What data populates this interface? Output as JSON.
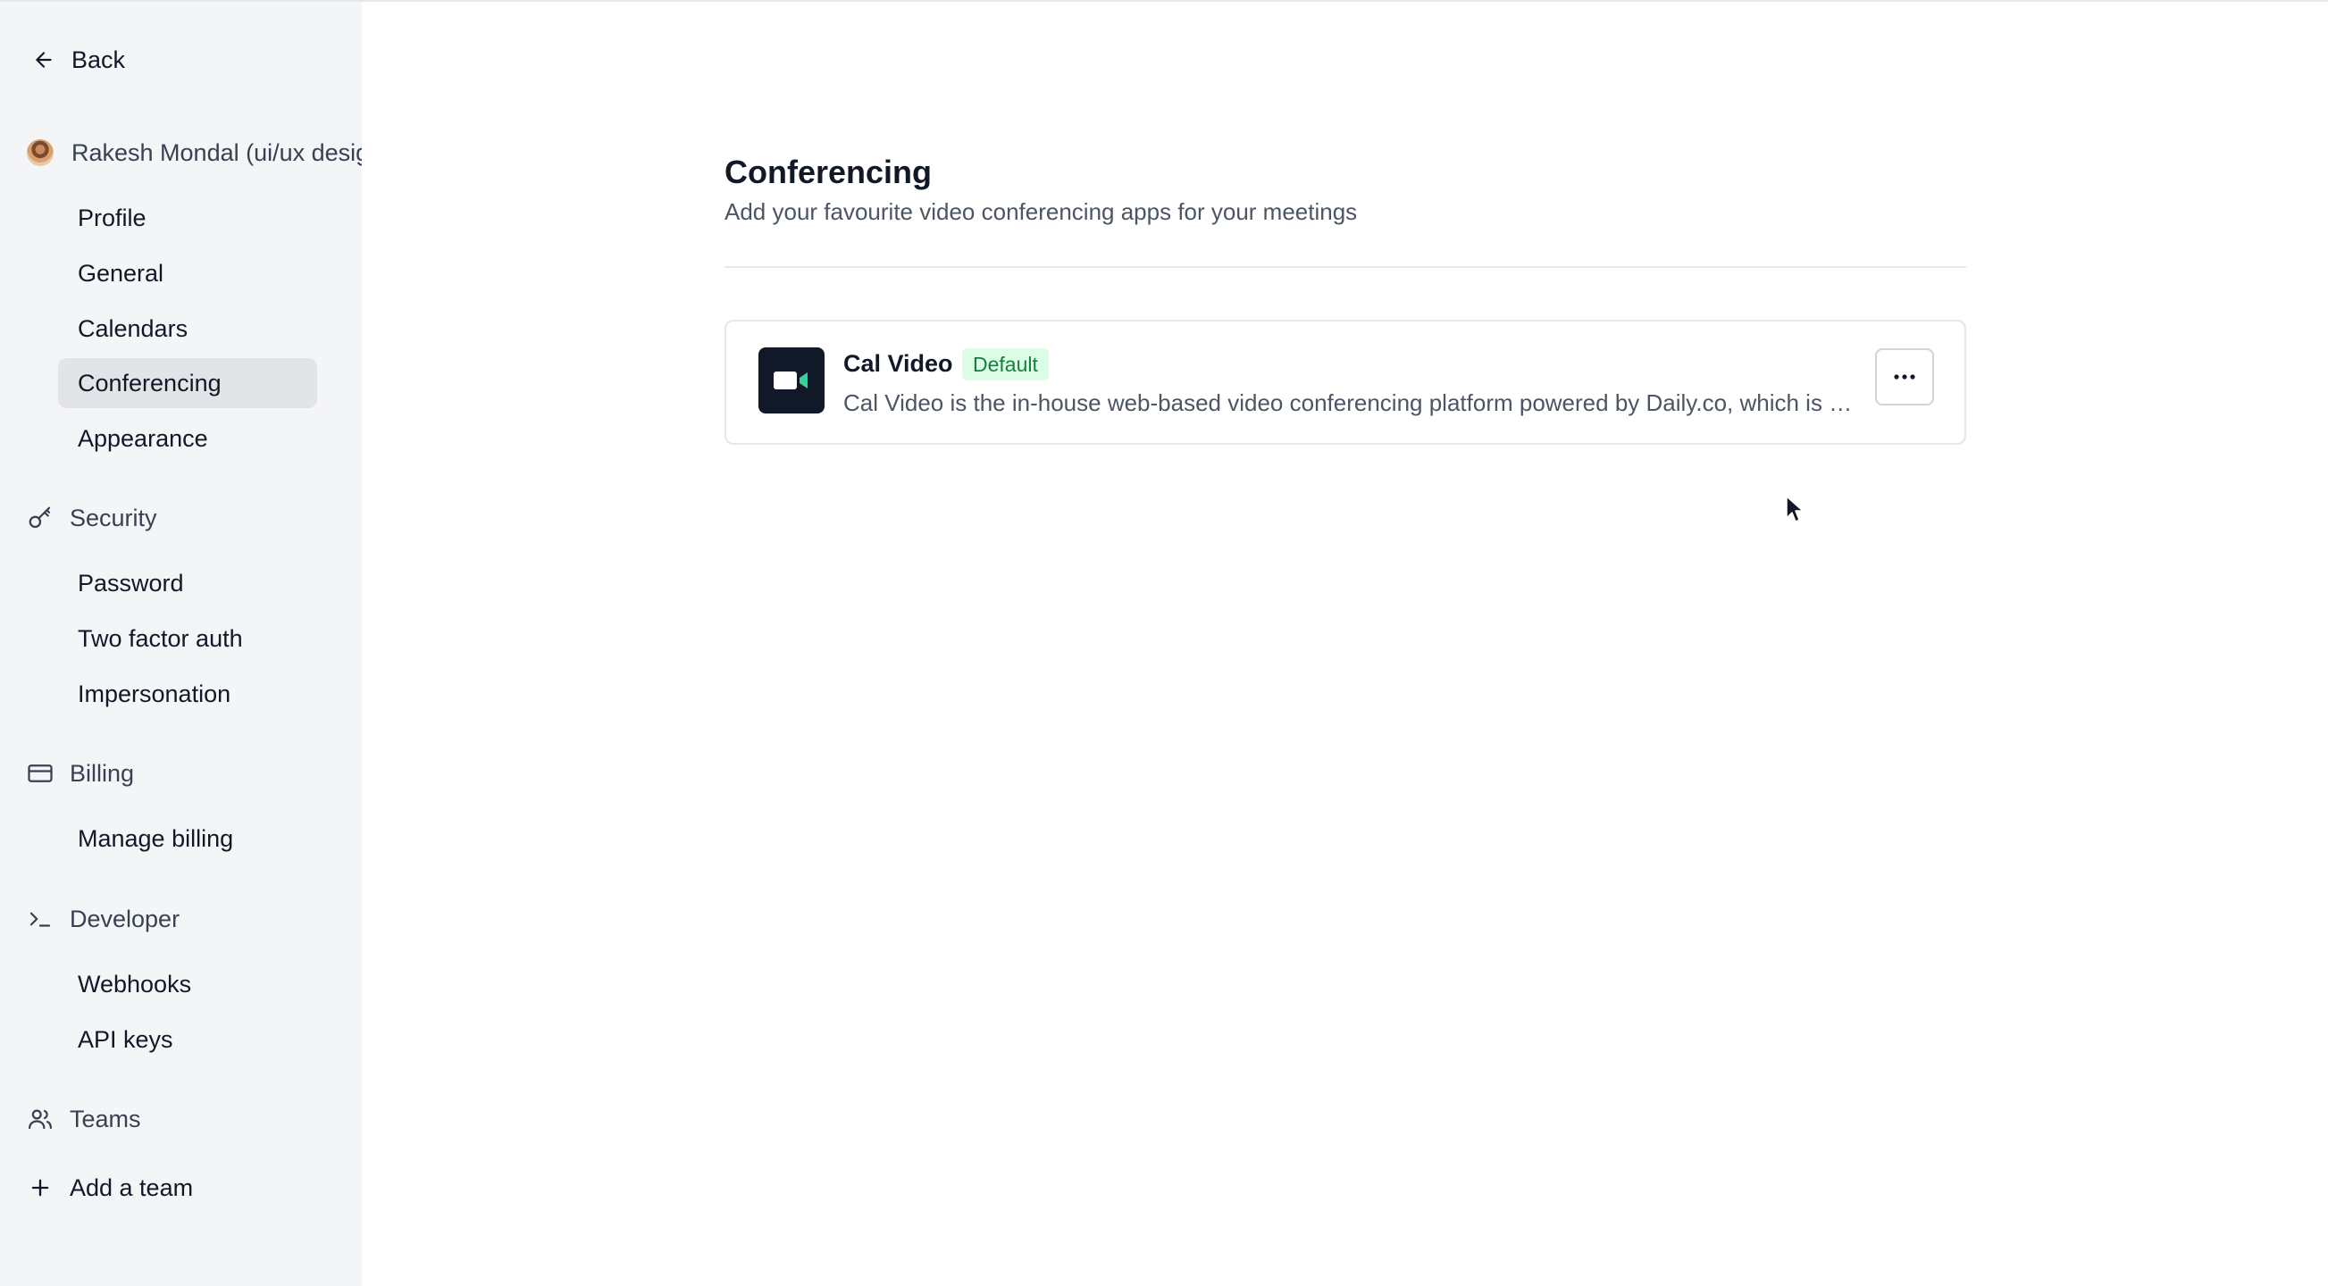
{
  "sidebar": {
    "back_label": "Back",
    "user_name": "Rakesh Mondal (ui/ux designer)",
    "account_items": [
      {
        "label": "Profile"
      },
      {
        "label": "General"
      },
      {
        "label": "Calendars"
      },
      {
        "label": "Conferencing",
        "active": true
      },
      {
        "label": "Appearance"
      }
    ],
    "security": {
      "label": "Security",
      "icon": "key-icon",
      "items": [
        {
          "label": "Password"
        },
        {
          "label": "Two factor auth"
        },
        {
          "label": "Impersonation"
        }
      ]
    },
    "billing": {
      "label": "Billing",
      "icon": "credit-card-icon",
      "items": [
        {
          "label": "Manage billing"
        }
      ]
    },
    "developer": {
      "label": "Developer",
      "icon": "terminal-icon",
      "items": [
        {
          "label": "Webhooks"
        },
        {
          "label": "API keys"
        }
      ]
    },
    "teams": {
      "label": "Teams",
      "icon": "users-icon"
    },
    "add_team_label": "Add a team"
  },
  "main": {
    "title": "Conferencing",
    "subtitle": "Add your favourite video conferencing apps for your meetings",
    "apps": [
      {
        "name": "Cal Video",
        "badge": "Default",
        "description": "Cal Video is the in-house web-based video conferencing platform powered by Daily.co, which is minimalistic and lightweight, but has most of the features you need.",
        "icon": "video-camera-icon"
      }
    ]
  },
  "colors": {
    "sidebar_bg": "#f4f5f7",
    "active_item_bg": "#e3e4e7",
    "badge_bg": "#dcfce7",
    "badge_text": "#15803d",
    "app_logo_bg": "#111827",
    "app_logo_accent": "#34d399"
  }
}
